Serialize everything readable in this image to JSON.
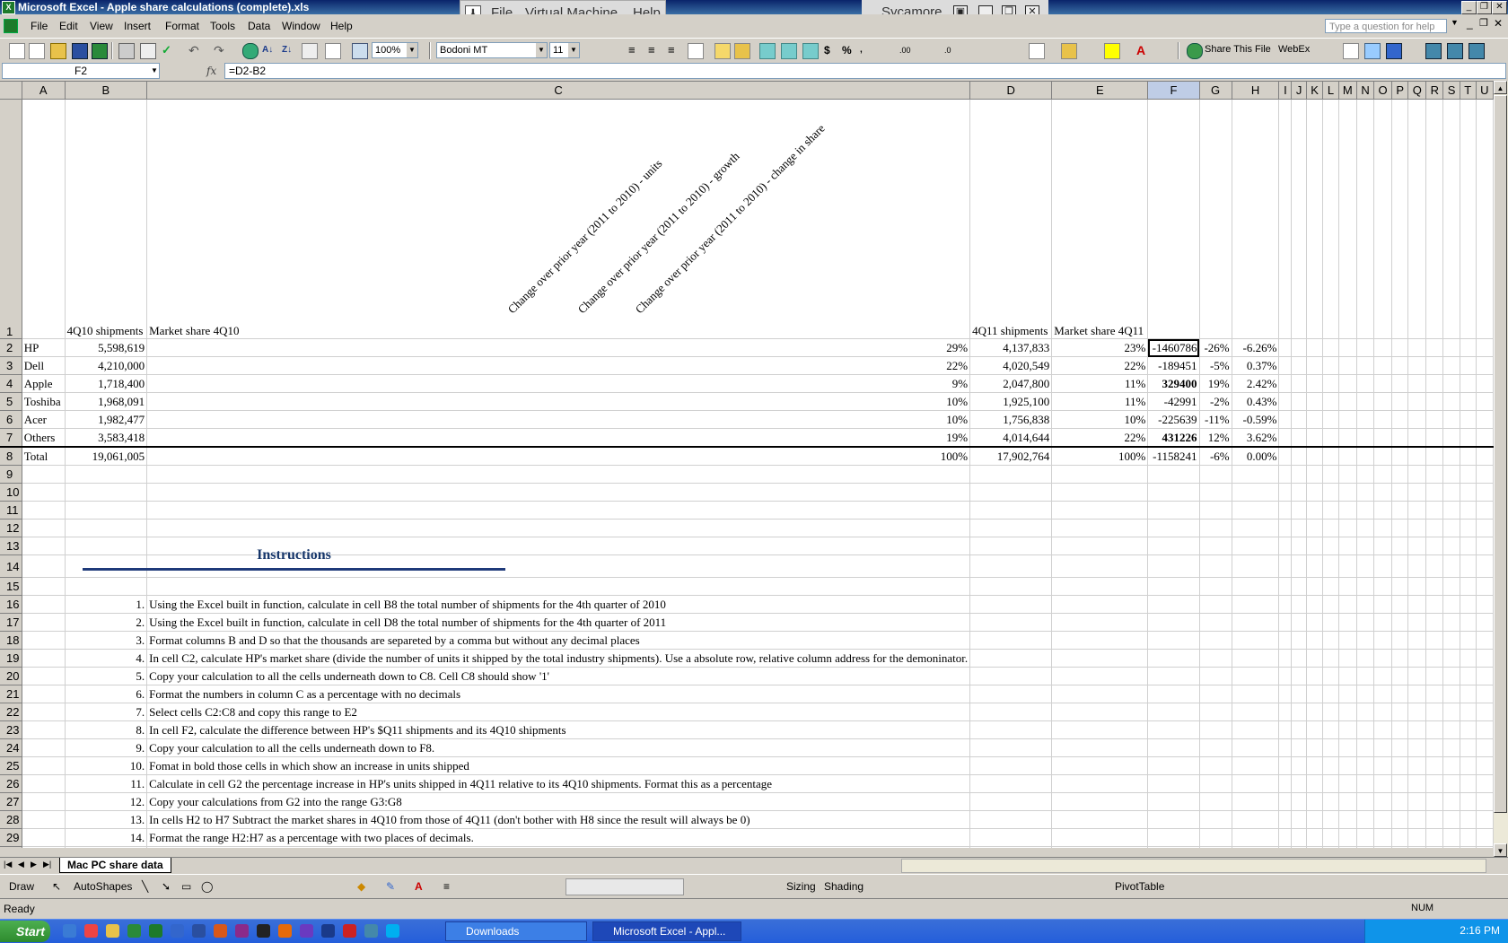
{
  "window": {
    "title": "Microsoft Excel - Apple share calculations (complete).xls",
    "app_icon": "excel-icon"
  },
  "vm": {
    "menu": [
      "File",
      "Virtual Machine",
      "Help"
    ],
    "name": "Sycamore"
  },
  "menubar": {
    "items": [
      "File",
      "Edit",
      "View",
      "Insert",
      "Format",
      "Tools",
      "Data",
      "Window",
      "Help"
    ],
    "help_placeholder": "Type a question for help"
  },
  "toolbar": {
    "zoom": "100%",
    "font": "Bodoni MT",
    "font_size": "11",
    "share_label": "Share This File",
    "webex_label": "WebEx"
  },
  "formula_bar": {
    "name_box": "F2",
    "fx": "fx",
    "formula": "=D2-B2"
  },
  "sheet": {
    "columns": [
      "A",
      "B",
      "C",
      "D",
      "E",
      "F",
      "G",
      "H",
      "I",
      "J",
      "K",
      "L",
      "M",
      "N",
      "O",
      "P",
      "Q",
      "R",
      "S",
      "T",
      "U"
    ],
    "header_row": {
      "b": "4Q10 shipments",
      "c": "Market share 4Q10",
      "d": "4Q11 shipments",
      "e": "Market share 4Q11",
      "f": "Change over prior year (2011 to 2010) - units",
      "g": "Change over prior year (2011 to 2010) - growth",
      "h": "Change over prior year (2011 to 2010) - change in share"
    },
    "rows": [
      {
        "a": "HP",
        "b": "5,598,619",
        "c": "29%",
        "d": "4,137,833",
        "e": "23%",
        "f": "-1460786",
        "g": "-26%",
        "h": "-6.26%"
      },
      {
        "a": "Dell",
        "b": "4,210,000",
        "c": "22%",
        "d": "4,020,549",
        "e": "22%",
        "f": "-189451",
        "g": "-5%",
        "h": "0.37%"
      },
      {
        "a": "Apple",
        "b": "1,718,400",
        "c": "9%",
        "d": "2,047,800",
        "e": "11%",
        "f": "329400",
        "g": "19%",
        "h": "2.42%"
      },
      {
        "a": "Toshiba",
        "b": "1,968,091",
        "c": "10%",
        "d": "1,925,100",
        "e": "11%",
        "f": "-42991",
        "g": "-2%",
        "h": "0.43%"
      },
      {
        "a": "Acer",
        "b": "1,982,477",
        "c": "10%",
        "d": "1,756,838",
        "e": "10%",
        "f": "-225639",
        "g": "-11%",
        "h": "-0.59%"
      },
      {
        "a": "Others",
        "b": "3,583,418",
        "c": "19%",
        "d": "4,014,644",
        "e": "22%",
        "f": "431226",
        "g": "12%",
        "h": "3.62%"
      },
      {
        "a": "Total",
        "b": "19,061,005",
        "c": "100%",
        "d": "17,902,764",
        "e": "100%",
        "f": "-1158241",
        "g": "-6%",
        "h": "0.00%"
      }
    ],
    "instructions_title": "Instructions",
    "instructions": [
      {
        "n": "1.",
        "text": "Using the Excel built in function, calculate in cell B8 the total number of shipments for the 4th quarter of 2010"
      },
      {
        "n": "2.",
        "text": "Using the Excel built in function, calculate in cell D8 the total number of shipments for the 4th quarter of 2011"
      },
      {
        "n": "3.",
        "text": "Format columns B and D so that the thousands are separeted by a comma but without any decimal places"
      },
      {
        "n": "4.",
        "text": "In cell C2, calculate HP's market share (divide the number of units it shipped by the total industry shipments). Use a absolute row, relative column address for the demoninator."
      },
      {
        "n": "5.",
        "text": "Copy your calculation to all the cells underneath down to C8. Cell C8 should show '1'"
      },
      {
        "n": "6.",
        "text": "Format the numbers in column C as a percentage with no decimals"
      },
      {
        "n": "7.",
        "text": "Select cells C2:C8 and copy this range to E2"
      },
      {
        "n": "8.",
        "text": "In cell F2, calculate the difference between HP's $Q11 shipments and its 4Q10 shipments"
      },
      {
        "n": "9.",
        "text": "Copy your calculation to all the cells underneath down to F8."
      },
      {
        "n": "10.",
        "text": "Fomat in bold those cells in which show an increase in units shipped"
      },
      {
        "n": "11.",
        "text": "Calculate in cell G2 the percentage increase in HP's units shipped in 4Q11 relative to its 4Q10 shipments. Format this as a percentage"
      },
      {
        "n": "12.",
        "text": "Copy your calculations from G2 into the range G3:G8"
      },
      {
        "n": "13.",
        "text": "In cells H2 to H7 Subtract the market shares in 4Q10 from those of 4Q11 (don't bother with H8 since the result will always be 0)"
      },
      {
        "n": "14.",
        "text": "Format the range H2:H7 as a percentage with two places of decimals."
      }
    ],
    "tab_name": "Mac PC share data"
  },
  "drawbar": {
    "draw": "Draw",
    "autoshapes": "AutoShapes",
    "sizing": "Sizing",
    "shading": "Shading",
    "pivot": "PivotTable"
  },
  "status": {
    "ready": "Ready",
    "num": "NUM"
  },
  "taskbar": {
    "start": "Start",
    "tasks": [
      "Downloads",
      "Microsoft Excel - Appl..."
    ],
    "clock": "2:16 PM"
  }
}
